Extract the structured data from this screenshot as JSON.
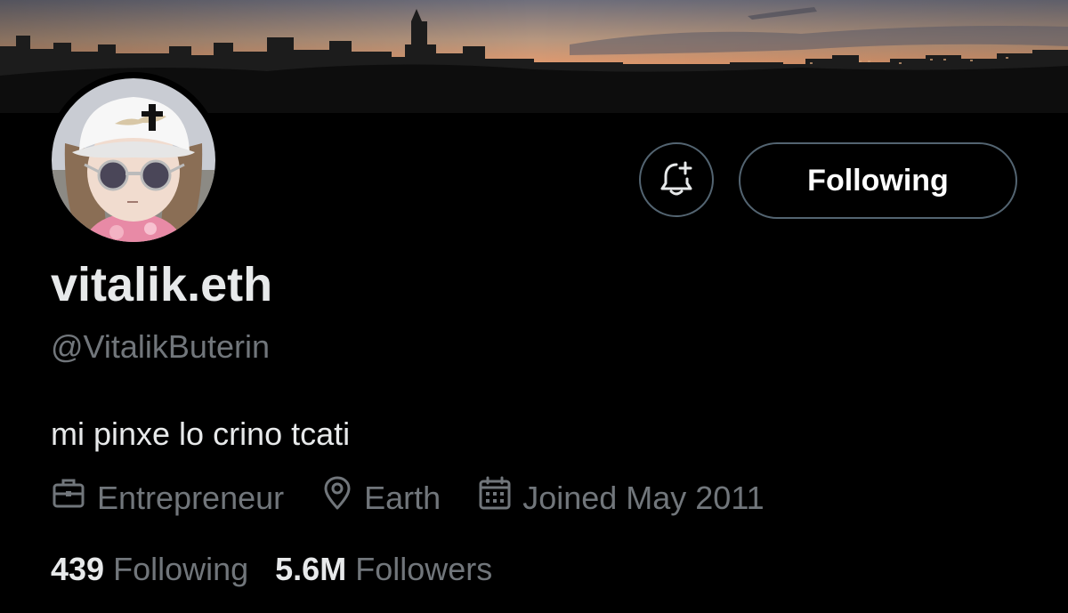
{
  "profile": {
    "display_name": "vitalik.eth",
    "handle": "@VitalikButerin",
    "bio": "mi pinxe lo crino tcati",
    "occupation": "Entrepreneur",
    "location": "Earth",
    "joined": "Joined May 2011",
    "following_count": "439",
    "following_label": "Following",
    "followers_count": "5.6M",
    "followers_label": "Followers"
  },
  "actions": {
    "follow_label": "Following"
  },
  "icons": {
    "notify": "bell-plus-icon",
    "occupation": "briefcase-icon",
    "location": "location-pin-icon",
    "joined": "calendar-icon"
  },
  "colors": {
    "background": "#000000",
    "primary_text": "#e7e9ea",
    "secondary_text": "#71767b",
    "button_border": "#536471"
  }
}
